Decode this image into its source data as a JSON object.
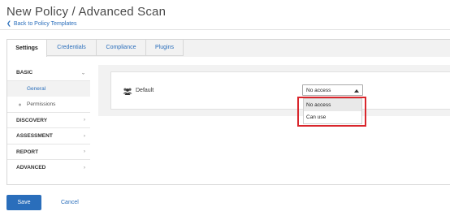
{
  "header": {
    "title": "New Policy / Advanced Scan",
    "back_link": "Back to Policy Templates"
  },
  "tabs": [
    {
      "label": "Settings",
      "active": true
    },
    {
      "label": "Credentials",
      "active": false
    },
    {
      "label": "Compliance",
      "active": false
    },
    {
      "label": "Plugins",
      "active": false
    }
  ],
  "sidebar": {
    "basic": {
      "label": "BASIC",
      "children": [
        "General",
        "Permissions"
      ]
    },
    "discovery": "DISCOVERY",
    "assessment": "ASSESSMENT",
    "report": "REPORT",
    "advanced": "ADVANCED"
  },
  "permissions": {
    "row_label": "Default",
    "selected": "No access",
    "options": [
      "No access",
      "Can use"
    ]
  },
  "footer": {
    "save_label": "Save",
    "cancel_label": "Cancel"
  },
  "colors": {
    "accent": "#2a6ebb",
    "highlight_border": "#d9262c",
    "panel_bg": "#f2f2f2"
  }
}
